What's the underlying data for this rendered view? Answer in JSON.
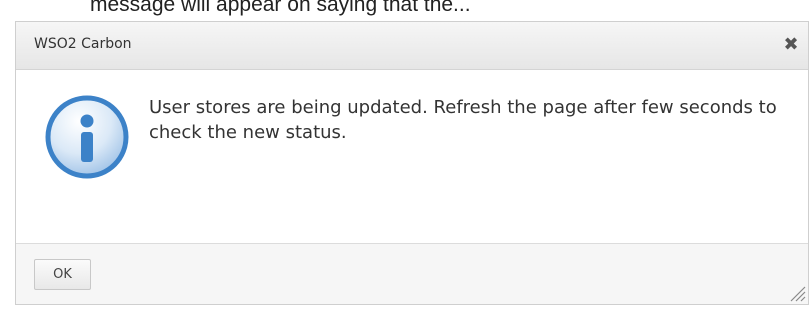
{
  "page": {
    "caption": "message will appear on saying that the..."
  },
  "dialog": {
    "title": "WSO2 Carbon",
    "close_symbol": "✖",
    "icon": "info-icon",
    "message": "User stores are being updated. Refresh the page after few seconds to check the new status.",
    "ok_label": "OK"
  },
  "colors": {
    "icon_blue": "#3c82c8",
    "title_bg": "#ececec",
    "text": "#333333"
  }
}
